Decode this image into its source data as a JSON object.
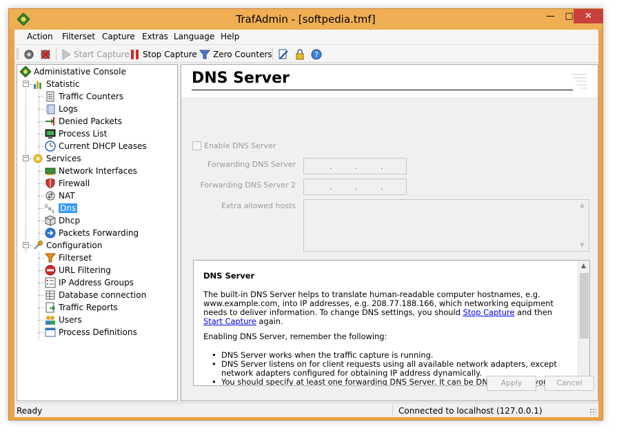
{
  "window": {
    "title": "TrafAdmin - [softpedia.tmf]",
    "minimize": "—",
    "maximize": "□",
    "close": "✕"
  },
  "menu": [
    "Action",
    "Filterset",
    "Capture",
    "Extras",
    "Language",
    "Help"
  ],
  "toolbar": {
    "start_capture": "Start Capture",
    "stop_capture": "Stop Capture",
    "zero_counters": "Zero Counters"
  },
  "tree": {
    "root": "Administative Console",
    "statistic": "Statistic",
    "statistic_items": [
      "Traffic Counters",
      "Logs",
      "Denied Packets",
      "Process List",
      "Current DHCP Leases"
    ],
    "services": "Services",
    "services_items": [
      "Network Interfaces",
      "Firewall",
      "NAT",
      "Dns",
      "Dhcp",
      "Packets Forwarding"
    ],
    "configuration": "Configuration",
    "configuration_items": [
      "Filterset",
      "URL Filtering",
      "IP Address Groups",
      "Database connection",
      "Traffic Reports",
      "Users",
      "Process Definitions"
    ],
    "selected": "Dns"
  },
  "content": {
    "title": "DNS Server",
    "enable_label": "Enable DNS Server",
    "enable_checked": false,
    "forwarding_label": "Forwarding DNS Server",
    "forwarding_value": ". . .",
    "forwarding2_label": "Forwarding DNS Server 2",
    "forwarding2_value": ". . .",
    "extra_hosts_label": "Extra allowed hosts",
    "extra_hosts_value": ""
  },
  "help": {
    "heading": "DNS Server",
    "p1_before": "The built-in DNS Server helps to translate human-readable computer hostnames, e.g. www.example.com, into IP addresses, e.g. 208.77.188.166, which networking equipment needs to deliver information. To change DNS settings, you should ",
    "p1_link1": "Stop Capture",
    "p1_middle": " and then ",
    "p1_link2": "Start Capture",
    "p1_after": " again.",
    "p2": "Enabling DNS Server, remember the following:",
    "bullets": [
      "DNS Server works when the traffic capture is running.",
      "DNS Server listens on for client requests using all available network adapters, except network adapters configured for obtaining IP address dynamically.",
      "You should specify at least one forwarding DNS Server. It can be DNS Server of your"
    ]
  },
  "buttons": {
    "apply": "Apply",
    "cancel": "Cancel"
  },
  "status": {
    "left": "Ready",
    "right": "Connected to localhost (127.0.0.1)"
  },
  "colors": {
    "titlebar": "#f0ae54",
    "close_button": "#c7413a",
    "selection": "#3399ff",
    "link": "#0000ee"
  }
}
